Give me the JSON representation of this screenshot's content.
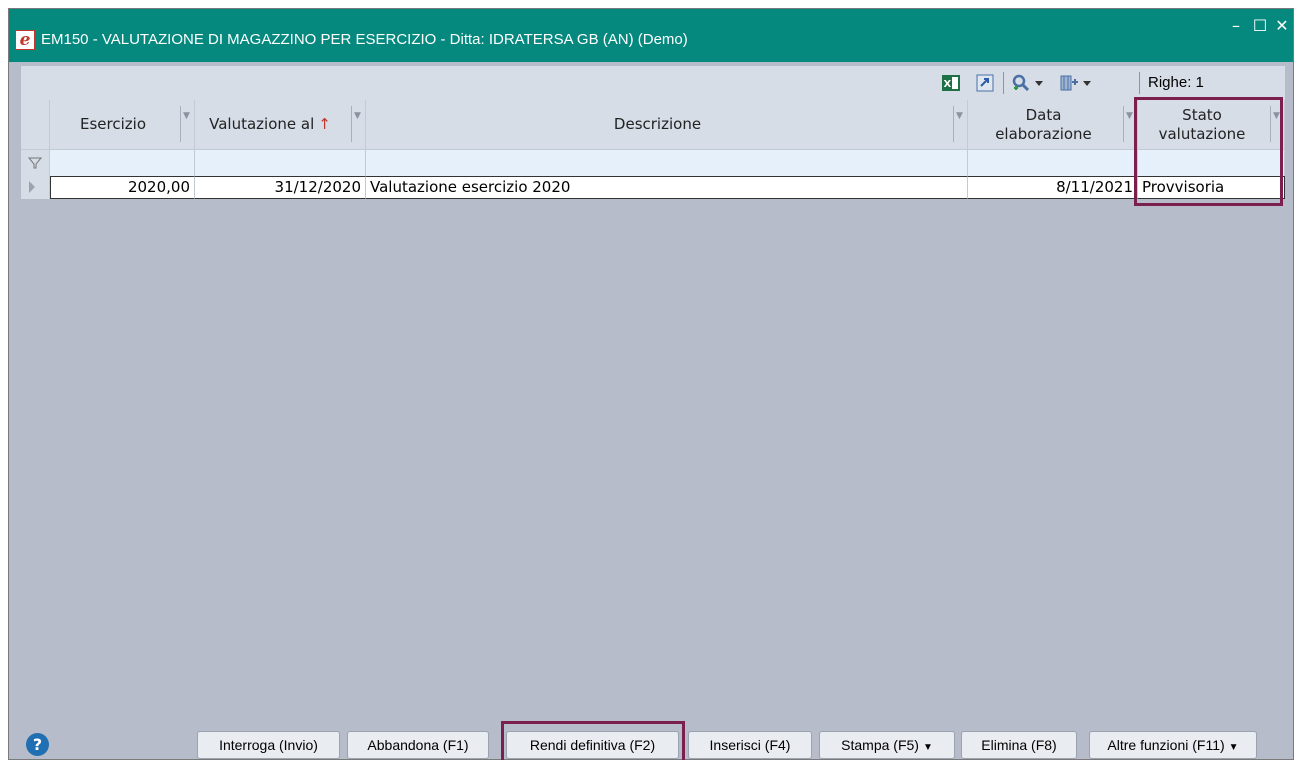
{
  "window": {
    "title": "EM150 - VALUTAZIONE DI MAGAZZINO PER ESERCIZIO - Ditta: IDRATERSA GB (AN)  (Demo)",
    "app_icon": "e-logo-icon",
    "controls": {
      "minimize": "–",
      "maximize": "☐",
      "close": "✕"
    }
  },
  "toolbar": {
    "excel_icon": "excel-export-icon",
    "export_icon": "export-icon",
    "search_icon": "search-icon",
    "columns_icon": "column-chooser-icon",
    "rows_label": "Righe: 1"
  },
  "grid": {
    "columns": [
      {
        "label": "Esercizio",
        "sort": null
      },
      {
        "label": "Valutazione al",
        "sort": "↑"
      },
      {
        "label": "Descrizione",
        "sort": null
      },
      {
        "label": "Data elaborazione",
        "sort": null
      },
      {
        "label": "Stato valutazione",
        "sort": null
      }
    ],
    "rows": [
      {
        "esercizio": "2020,00",
        "valutazione_al": "31/12/2020",
        "descrizione": "Valutazione esercizio 2020",
        "data_elaborazione": "8/11/2021",
        "stato_valutazione": "Provvisoria"
      }
    ],
    "filter_icon": "filter-icon",
    "row_indicator_icon": "row-pointer-icon"
  },
  "footer": {
    "help_icon": "help-icon",
    "help_glyph": "?",
    "buttons": [
      {
        "label": "Interroga (Invio)"
      },
      {
        "label": "Abbandona (F1)"
      },
      {
        "label": "Rendi definitiva (F2)"
      },
      {
        "label": "Inserisci (F4)"
      },
      {
        "label": "Stampa (F5)"
      },
      {
        "label": "Elimina (F8)"
      },
      {
        "label": "Altre funzioni (F11)"
      }
    ]
  },
  "colors": {
    "titlebar": "#05887e",
    "highlight": "#7b1f4e",
    "sort_arrow": "#c0392b"
  }
}
